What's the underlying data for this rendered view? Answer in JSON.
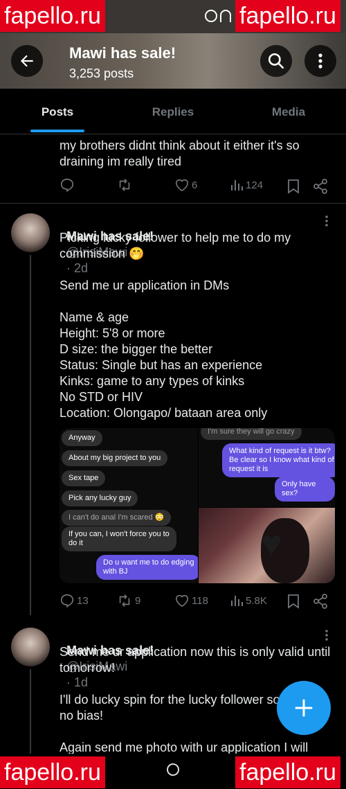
{
  "watermark": "fapello.ru",
  "header": {
    "title": "Mawi has sale!",
    "post_count": "3,253 posts"
  },
  "tabs": [
    {
      "label": "Posts"
    },
    {
      "label": "Replies"
    },
    {
      "label": "Media"
    }
  ],
  "posts": [
    {
      "text": "my brothers didnt think about it either it's so\ndraining im really tired",
      "likes": "6",
      "views": "124"
    },
    {
      "display_name": "Mawi has sale!",
      "handle": "@IrisiMawi",
      "age": "· 2d",
      "text": "Picking lucky follower to help me to do my\ncommission 🤭\n\nSend me ur application in DMs\n\nName & age\nHeight: 5'8 or more\nD size: the bigger the better\nStatus: Single but has an experience\nKinks: game to any types of kinks\nNo STD or HIV\nLocation: Olongapo/ bataan area only",
      "chat1": [
        "Anyway",
        "About my big project to you",
        "Sex tape",
        "Pick any lucky guy"
      ],
      "chat2_top": "I'm sure they will go crazy",
      "chat2_out": "What kind of request is it btw?\nBe clear so I know what kind of\nrequest it is",
      "chat2_out2": "Only have sex?",
      "chat3_in1": "I can't do anal I'm scared 😳",
      "chat3_in2": "If you can, I won't force you to\ndo it",
      "chat3_out": "Do u want me to do edging\nwith BJ",
      "replies": "13",
      "reposts": "9",
      "likes": "118",
      "views": "5.8K"
    },
    {
      "display_name": "Mawi has sale!",
      "handle": "@IrisiMawi",
      "age": "· 1d",
      "text": "Send me ur application now this is only valid until\ntomorrow!\n\nI'll do lucky spin for the lucky follower so\nno bias!\n\nAgain send me photo with ur application I will"
    }
  ],
  "colors": {
    "accent": "#1d9bf0",
    "watermark": "#e3001b",
    "chat_out": "#6453e0"
  },
  "icons": [
    "back-arrow-icon",
    "search-icon",
    "more-vertical-icon",
    "reply-icon",
    "repost-icon",
    "heart-icon",
    "views-icon",
    "bookmark-icon",
    "share-icon",
    "compose-plus-icon",
    "home-circle-icon"
  ]
}
